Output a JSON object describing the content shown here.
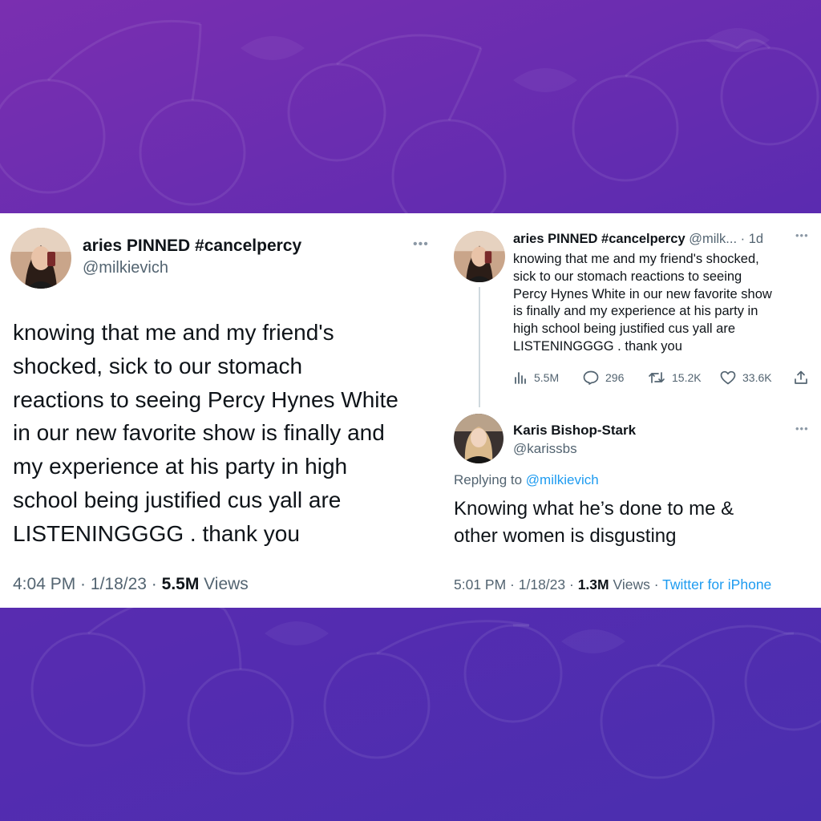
{
  "left_tweet": {
    "display_name": "aries PINNED #cancelpercy",
    "handle": "@milkievich",
    "more_icon": "more-dots-icon",
    "text_lines": [
      "knowing that me and my friend's",
      "shocked, sick to our stomach",
      "reactions to seeing Percy Hynes White",
      "in our new favorite show is finally and",
      "my experience at his party in high",
      "school being justified cus yall are",
      "LISTENINGGGG . thank you"
    ],
    "time": "4:04 PM",
    "date": "1/18/23",
    "views_count": "5.5M",
    "views_label": "Views"
  },
  "right_tweet": {
    "display_name": "aries PINNED #cancelpercy",
    "handle_truncated": "@milk...",
    "age": "1d",
    "text_lines": [
      "knowing that me and my friend's shocked,",
      "sick to our stomach reactions to seeing",
      "Percy Hynes White in our new favorite show",
      "is finally and my experience at his party in",
      "high school being justified cus yall are",
      "LISTENINGGGG . thank you"
    ],
    "actions": {
      "views": "5.5M",
      "replies": "296",
      "retweets": "15.2K",
      "likes": "33.6K"
    }
  },
  "reply_tweet": {
    "display_name": "Karis Bishop-Stark",
    "handle": "@karissbs",
    "replying_prefix": "Replying to",
    "replying_to": "@milkievich",
    "text_lines": [
      "Knowing what he’s done to me &",
      "other women is disgusting"
    ],
    "time": "5:01 PM",
    "date": "1/18/23",
    "views_count": "1.3M",
    "views_label": "Views",
    "source": "Twitter for iPhone"
  },
  "colors": {
    "background_top": "#7a2fb0",
    "background_bottom": "#4a2eaf",
    "text_primary": "#0f1419",
    "text_secondary": "#536471",
    "link": "#1d9bf0"
  }
}
